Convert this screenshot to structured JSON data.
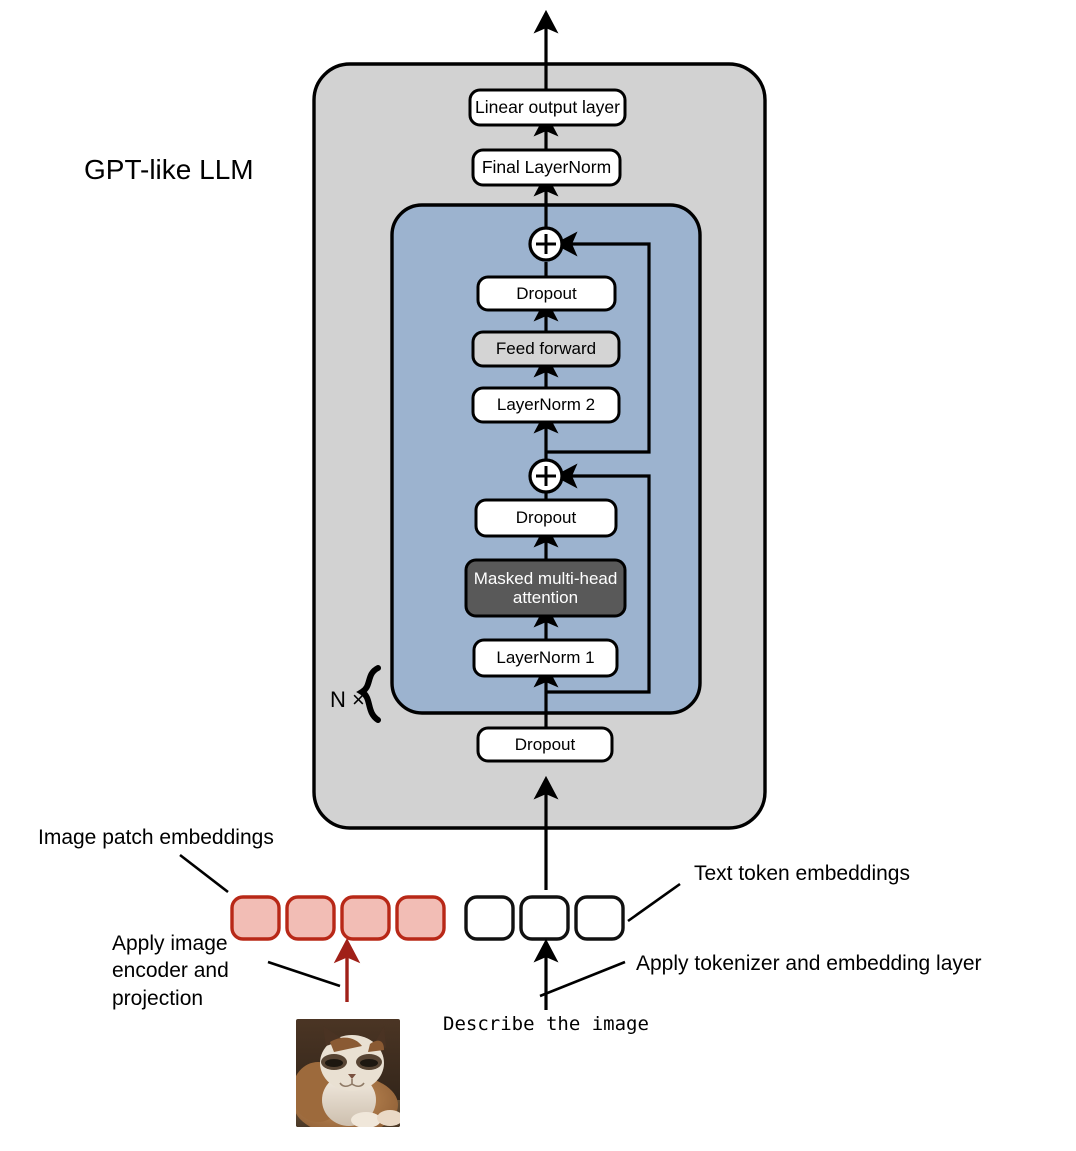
{
  "diagram": {
    "title": "GPT-like LLM",
    "repeat_label": "N ×",
    "outer_box_color": "#d2d2d2",
    "transformer_block_color": "#9cb3cf",
    "attention_box_color": "#595959",
    "feedforward_box_color": "#d4d4d4",
    "patch_fill_color": "#f2bdb5",
    "patch_border_color": "#b82817",
    "token_border_color": "#111111",
    "line_color": "#000000",
    "residual_symbol": "+"
  },
  "blocks": {
    "linear_output": "Linear output layer",
    "final_layernorm": "Final LayerNorm",
    "dropout_after_ff": "Dropout",
    "feed_forward": "Feed forward",
    "layernorm_2": "LayerNorm 2",
    "dropout_after_attention": "Dropout",
    "masked_attention": "Masked multi-head attention",
    "layernorm_1": "LayerNorm 1",
    "dropout_embeddings": "Dropout"
  },
  "annotations": {
    "image_patch_embeddings": "Image patch embeddings",
    "text_token_embeddings": "Text token embeddings",
    "apply_image_encoder": "Apply image\nencoder and\nprojection",
    "apply_tokenizer": "Apply tokenizer and embedding layer",
    "prompt_text": "Describe the image"
  },
  "embeddings": {
    "image_patches": [
      {
        "label": "patch-1"
      },
      {
        "label": "patch-2"
      },
      {
        "label": "patch-3"
      },
      {
        "label": "patch-4"
      }
    ],
    "text_tokens": [
      {
        "label": "token-1"
      },
      {
        "label": "token-2"
      },
      {
        "label": "token-3"
      }
    ]
  },
  "media": {
    "cat_image_alt": "Photo of a calico cat"
  }
}
